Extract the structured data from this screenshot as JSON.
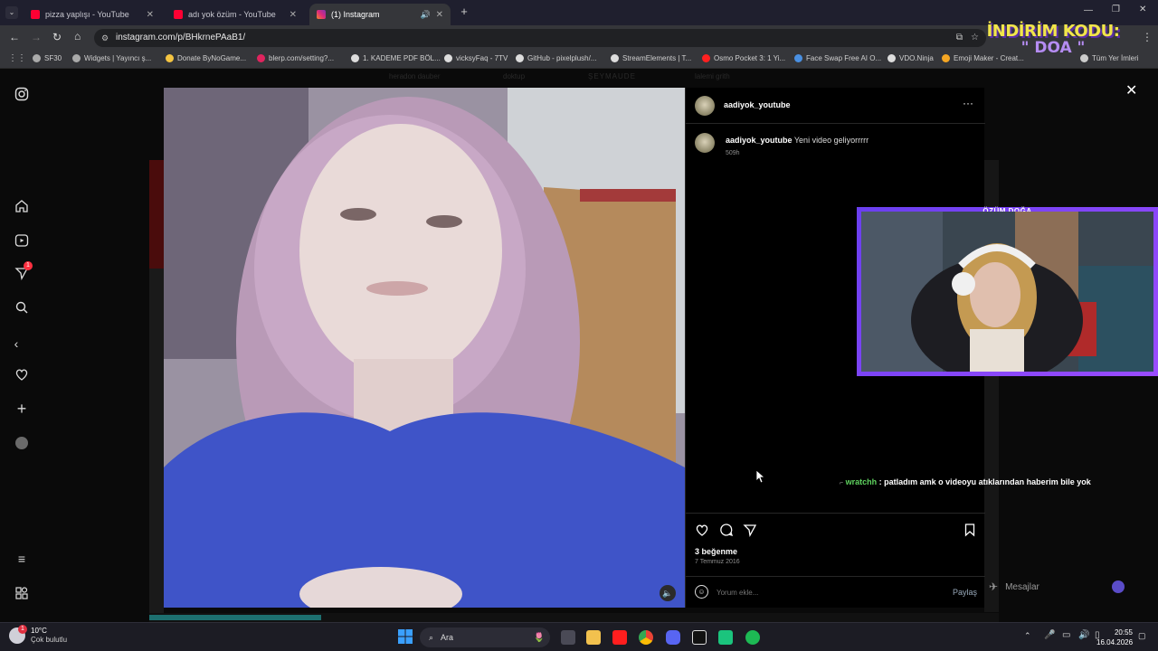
{
  "browser": {
    "tabs": [
      {
        "label": "pizza yaplışı - YouTube",
        "color": "#ff0033"
      },
      {
        "label": "adı yok özüm - YouTube",
        "color": "#ff0033"
      },
      {
        "label": "(1) Instagram",
        "color": "#e1306c"
      }
    ],
    "url": "instagram.com/p/BHkrnePAaB1/",
    "bookmarks": [
      {
        "label": "SF30",
        "color": "#aaa"
      },
      {
        "label": "Widgets | Yayıncı ş...",
        "color": "#aaa"
      },
      {
        "label": "Donate ByNoGame...",
        "color": "#f5c542"
      },
      {
        "label": "blerp.com/setting?...",
        "color": "#e0245e"
      },
      {
        "label": "1. KADEME PDF BÖL...",
        "color": "#ddd"
      },
      {
        "label": "vicksyFaq - 7TV",
        "color": "#ddd"
      },
      {
        "label": "GitHub - pixelplush/...",
        "color": "#ddd"
      },
      {
        "label": "StreamElements | T...",
        "color": "#ddd"
      },
      {
        "label": "Osmo Pocket 3: 1 Yi...",
        "color": "#ff2020"
      },
      {
        "label": "Face Swap Free AI O...",
        "color": "#4a90e2"
      },
      {
        "label": "VDO.Ninja",
        "color": "#ddd"
      },
      {
        "label": "Emoji Maker - Creat...",
        "color": "#f5a623"
      },
      {
        "label": "Tüm Yer İmleri",
        "color": "#ccc"
      }
    ]
  },
  "overlay": {
    "promo_line1": "İNDİRİM KODU:",
    "promo_line2": "\" DOA \"",
    "streamer_name": "ÖZÜM DOĞA"
  },
  "faint_bg": [
    "heradon dauber",
    "doktup",
    "ŞEYMAUDE",
    "lalemi grith"
  ],
  "post": {
    "username": "aadiyok_youtube",
    "caption_user": "aadiyok_youtube",
    "caption_text": "Yeni video geliyorrrrr",
    "caption_time": "509h",
    "likes": "3 beğenme",
    "date": "7 Temmuz 2016",
    "comment_placeholder": "Yorum ekle...",
    "share_label": "Paylaş",
    "more_label": "···"
  },
  "chat": {
    "user": "wratchh",
    "message": ": patladım amk o videoyu atıklarından haberim bile yok"
  },
  "messages_label": "Mesajlar",
  "notif_count": "1",
  "taskbar": {
    "weather_temp": "10°C",
    "weather_desc": "Çok bulutlu",
    "search_label": "Ara",
    "time": "20:55",
    "date": "16.04.2026",
    "weather_badge": "1"
  },
  "colors": {
    "accent_purple": "#7b3ff2",
    "promo_yellow": "#f2e64a",
    "chat_user_green": "#5fd35f"
  }
}
